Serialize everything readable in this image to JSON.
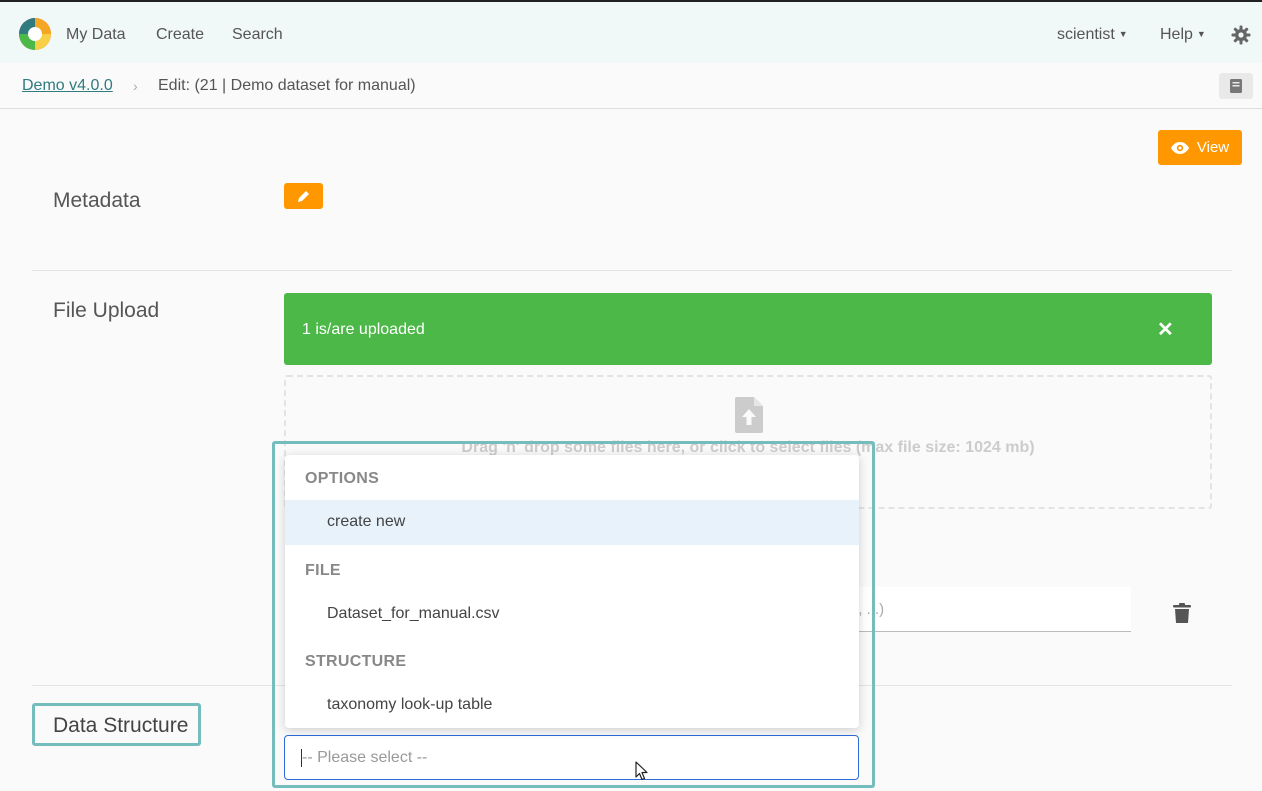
{
  "nav": {
    "items": [
      "My Data",
      "Create",
      "Search"
    ],
    "user": "scientist",
    "help": "Help"
  },
  "breadcrumb": {
    "home": "Demo v4.0.0",
    "separator": "›",
    "current": "Edit: (21 | Demo dataset for manual)"
  },
  "toolbar": {
    "view_label": "View"
  },
  "sections": {
    "metadata": "Metadata",
    "file_upload": "File Upload",
    "data_structure": "Data Structure"
  },
  "alert": {
    "text": "1 is/are uploaded",
    "close": "✕"
  },
  "dropzone": {
    "text": "Drag 'n' drop some files here, or click to select files (max file size: 1024 mb)"
  },
  "file_row": {
    "name_placeholder_fragment": "n, ...)"
  },
  "dropdown": {
    "groups": [
      {
        "label": "OPTIONS",
        "options": [
          "create new"
        ]
      },
      {
        "label": "FILE",
        "options": [
          "Dataset_for_manual.csv"
        ]
      },
      {
        "label": "STRUCTURE",
        "options": [
          "taxonomy look-up table"
        ]
      }
    ],
    "placeholder": "-- Please select --"
  },
  "colors": {
    "accent": "#ff9800",
    "success": "#4cb848",
    "highlight": "#75bdbd",
    "link": "#2f7b7f"
  },
  "icons": {
    "logo": "app-logo-icon",
    "gear": "gear-icon",
    "doc": "document-icon",
    "eye": "eye-icon",
    "pencil": "pencil-icon",
    "upload": "file-upload-icon",
    "trash": "trash-icon"
  }
}
